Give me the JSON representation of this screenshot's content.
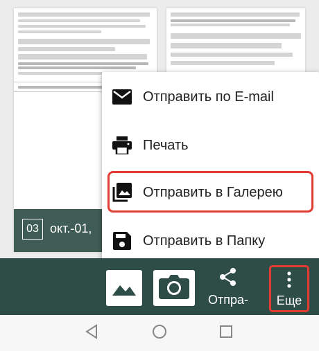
{
  "document": {
    "page_number": "03",
    "date": "окт.-01,"
  },
  "toolbar": {
    "gallery_icon": "image-icon",
    "camera_icon": "camera-icon",
    "share_icon": "share-icon",
    "share_label": "Отпра-",
    "more_icon": "more-vertical-icon",
    "more_label": "Еще",
    "highlight_color": "#e23b32",
    "bar_color": "#2d4d46"
  },
  "menu": {
    "items": [
      {
        "label": "Отправить по E-mail",
        "icon": "email-icon"
      },
      {
        "label": "Печать",
        "icon": "print-icon"
      },
      {
        "label": "Отправить в Галерею",
        "icon": "gallery-icon"
      },
      {
        "label": "Отправить в Папку",
        "icon": "save-icon"
      }
    ]
  },
  "navbar": {
    "back_icon": "back-icon",
    "home_icon": "home-icon",
    "recents_icon": "recents-icon"
  }
}
